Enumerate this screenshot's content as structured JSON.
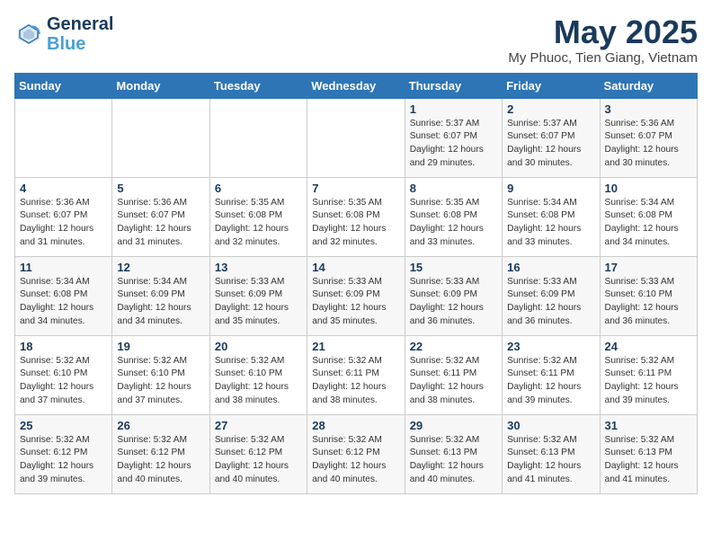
{
  "header": {
    "logo_line1": "General",
    "logo_line2": "Blue",
    "month_title": "May 2025",
    "subtitle": "My Phuoc, Tien Giang, Vietnam"
  },
  "weekdays": [
    "Sunday",
    "Monday",
    "Tuesday",
    "Wednesday",
    "Thursday",
    "Friday",
    "Saturday"
  ],
  "weeks": [
    [
      {
        "day": "",
        "info": ""
      },
      {
        "day": "",
        "info": ""
      },
      {
        "day": "",
        "info": ""
      },
      {
        "day": "",
        "info": ""
      },
      {
        "day": "1",
        "info": "Sunrise: 5:37 AM\nSunset: 6:07 PM\nDaylight: 12 hours\nand 29 minutes."
      },
      {
        "day": "2",
        "info": "Sunrise: 5:37 AM\nSunset: 6:07 PM\nDaylight: 12 hours\nand 30 minutes."
      },
      {
        "day": "3",
        "info": "Sunrise: 5:36 AM\nSunset: 6:07 PM\nDaylight: 12 hours\nand 30 minutes."
      }
    ],
    [
      {
        "day": "4",
        "info": "Sunrise: 5:36 AM\nSunset: 6:07 PM\nDaylight: 12 hours\nand 31 minutes."
      },
      {
        "day": "5",
        "info": "Sunrise: 5:36 AM\nSunset: 6:07 PM\nDaylight: 12 hours\nand 31 minutes."
      },
      {
        "day": "6",
        "info": "Sunrise: 5:35 AM\nSunset: 6:08 PM\nDaylight: 12 hours\nand 32 minutes."
      },
      {
        "day": "7",
        "info": "Sunrise: 5:35 AM\nSunset: 6:08 PM\nDaylight: 12 hours\nand 32 minutes."
      },
      {
        "day": "8",
        "info": "Sunrise: 5:35 AM\nSunset: 6:08 PM\nDaylight: 12 hours\nand 33 minutes."
      },
      {
        "day": "9",
        "info": "Sunrise: 5:34 AM\nSunset: 6:08 PM\nDaylight: 12 hours\nand 33 minutes."
      },
      {
        "day": "10",
        "info": "Sunrise: 5:34 AM\nSunset: 6:08 PM\nDaylight: 12 hours\nand 34 minutes."
      }
    ],
    [
      {
        "day": "11",
        "info": "Sunrise: 5:34 AM\nSunset: 6:08 PM\nDaylight: 12 hours\nand 34 minutes."
      },
      {
        "day": "12",
        "info": "Sunrise: 5:34 AM\nSunset: 6:09 PM\nDaylight: 12 hours\nand 34 minutes."
      },
      {
        "day": "13",
        "info": "Sunrise: 5:33 AM\nSunset: 6:09 PM\nDaylight: 12 hours\nand 35 minutes."
      },
      {
        "day": "14",
        "info": "Sunrise: 5:33 AM\nSunset: 6:09 PM\nDaylight: 12 hours\nand 35 minutes."
      },
      {
        "day": "15",
        "info": "Sunrise: 5:33 AM\nSunset: 6:09 PM\nDaylight: 12 hours\nand 36 minutes."
      },
      {
        "day": "16",
        "info": "Sunrise: 5:33 AM\nSunset: 6:09 PM\nDaylight: 12 hours\nand 36 minutes."
      },
      {
        "day": "17",
        "info": "Sunrise: 5:33 AM\nSunset: 6:10 PM\nDaylight: 12 hours\nand 36 minutes."
      }
    ],
    [
      {
        "day": "18",
        "info": "Sunrise: 5:32 AM\nSunset: 6:10 PM\nDaylight: 12 hours\nand 37 minutes."
      },
      {
        "day": "19",
        "info": "Sunrise: 5:32 AM\nSunset: 6:10 PM\nDaylight: 12 hours\nand 37 minutes."
      },
      {
        "day": "20",
        "info": "Sunrise: 5:32 AM\nSunset: 6:10 PM\nDaylight: 12 hours\nand 38 minutes."
      },
      {
        "day": "21",
        "info": "Sunrise: 5:32 AM\nSunset: 6:11 PM\nDaylight: 12 hours\nand 38 minutes."
      },
      {
        "day": "22",
        "info": "Sunrise: 5:32 AM\nSunset: 6:11 PM\nDaylight: 12 hours\nand 38 minutes."
      },
      {
        "day": "23",
        "info": "Sunrise: 5:32 AM\nSunset: 6:11 PM\nDaylight: 12 hours\nand 39 minutes."
      },
      {
        "day": "24",
        "info": "Sunrise: 5:32 AM\nSunset: 6:11 PM\nDaylight: 12 hours\nand 39 minutes."
      }
    ],
    [
      {
        "day": "25",
        "info": "Sunrise: 5:32 AM\nSunset: 6:12 PM\nDaylight: 12 hours\nand 39 minutes."
      },
      {
        "day": "26",
        "info": "Sunrise: 5:32 AM\nSunset: 6:12 PM\nDaylight: 12 hours\nand 40 minutes."
      },
      {
        "day": "27",
        "info": "Sunrise: 5:32 AM\nSunset: 6:12 PM\nDaylight: 12 hours\nand 40 minutes."
      },
      {
        "day": "28",
        "info": "Sunrise: 5:32 AM\nSunset: 6:12 PM\nDaylight: 12 hours\nand 40 minutes."
      },
      {
        "day": "29",
        "info": "Sunrise: 5:32 AM\nSunset: 6:13 PM\nDaylight: 12 hours\nand 40 minutes."
      },
      {
        "day": "30",
        "info": "Sunrise: 5:32 AM\nSunset: 6:13 PM\nDaylight: 12 hours\nand 41 minutes."
      },
      {
        "day": "31",
        "info": "Sunrise: 5:32 AM\nSunset: 6:13 PM\nDaylight: 12 hours\nand 41 minutes."
      }
    ]
  ]
}
